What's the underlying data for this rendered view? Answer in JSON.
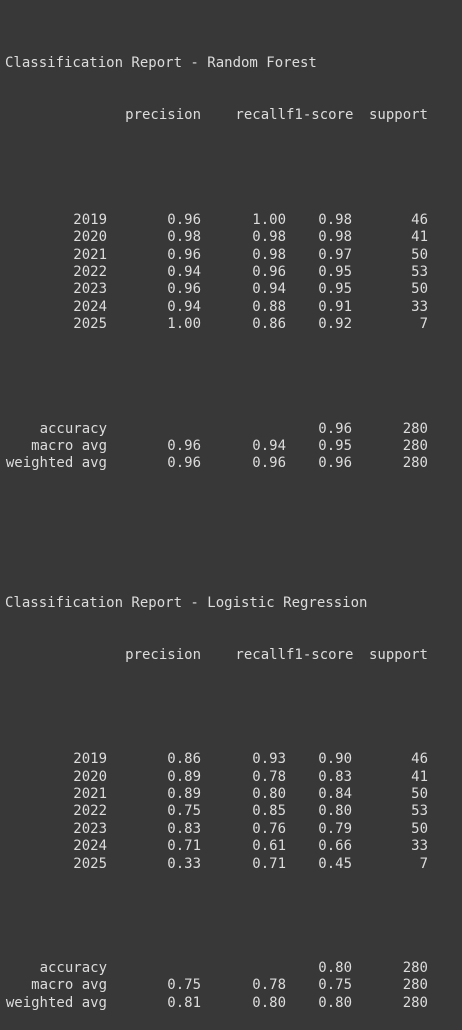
{
  "reports": [
    {
      "title": "Classification Report - Random Forest",
      "headers": [
        "precision",
        "recall",
        "f1-score",
        "support"
      ],
      "rows": [
        {
          "label": "2019",
          "precision": "0.96",
          "recall": "1.00",
          "f1": "0.98",
          "support": "46"
        },
        {
          "label": "2020",
          "precision": "0.98",
          "recall": "0.98",
          "f1": "0.98",
          "support": "41"
        },
        {
          "label": "2021",
          "precision": "0.96",
          "recall": "0.98",
          "f1": "0.97",
          "support": "50"
        },
        {
          "label": "2022",
          "precision": "0.94",
          "recall": "0.96",
          "f1": "0.95",
          "support": "53"
        },
        {
          "label": "2023",
          "precision": "0.96",
          "recall": "0.94",
          "f1": "0.95",
          "support": "50"
        },
        {
          "label": "2024",
          "precision": "0.94",
          "recall": "0.88",
          "f1": "0.91",
          "support": "33"
        },
        {
          "label": "2025",
          "precision": "1.00",
          "recall": "0.86",
          "f1": "0.92",
          "support": "7"
        }
      ],
      "summary": [
        {
          "label": "accuracy",
          "precision": "",
          "recall": "",
          "f1": "0.96",
          "support": "280"
        },
        {
          "label": "macro avg",
          "precision": "0.96",
          "recall": "0.94",
          "f1": "0.95",
          "support": "280"
        },
        {
          "label": "weighted avg",
          "precision": "0.96",
          "recall": "0.96",
          "f1": "0.96",
          "support": "280"
        }
      ]
    },
    {
      "title": "Classification Report - Logistic Regression",
      "headers": [
        "precision",
        "recall",
        "f1-score",
        "support"
      ],
      "rows": [
        {
          "label": "2019",
          "precision": "0.86",
          "recall": "0.93",
          "f1": "0.90",
          "support": "46"
        },
        {
          "label": "2020",
          "precision": "0.89",
          "recall": "0.78",
          "f1": "0.83",
          "support": "41"
        },
        {
          "label": "2021",
          "precision": "0.89",
          "recall": "0.80",
          "f1": "0.84",
          "support": "50"
        },
        {
          "label": "2022",
          "precision": "0.75",
          "recall": "0.85",
          "f1": "0.80",
          "support": "53"
        },
        {
          "label": "2023",
          "precision": "0.83",
          "recall": "0.76",
          "f1": "0.79",
          "support": "50"
        },
        {
          "label": "2024",
          "precision": "0.71",
          "recall": "0.61",
          "f1": "0.66",
          "support": "33"
        },
        {
          "label": "2025",
          "precision": "0.33",
          "recall": "0.71",
          "f1": "0.45",
          "support": "7"
        }
      ],
      "summary": [
        {
          "label": "accuracy",
          "precision": "",
          "recall": "",
          "f1": "0.80",
          "support": "280"
        },
        {
          "label": "macro avg",
          "precision": "0.75",
          "recall": "0.78",
          "f1": "0.75",
          "support": "280"
        },
        {
          "label": "weighted avg",
          "precision": "0.81",
          "recall": "0.80",
          "f1": "0.80",
          "support": "280"
        }
      ]
    }
  ]
}
